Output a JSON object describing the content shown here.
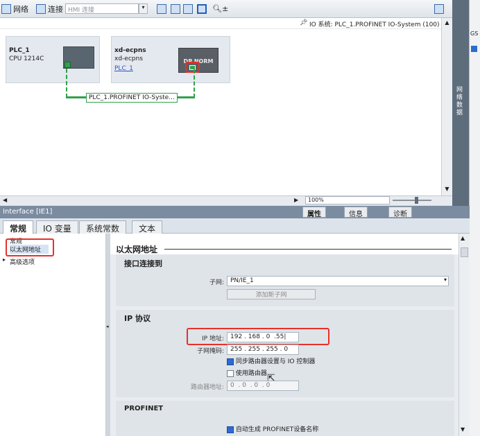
{
  "toolbar": {
    "network_label": "网络",
    "connection_label": "连接",
    "connection_type": "HMI 连接"
  },
  "canvas": {
    "io_system_label": "IO 系统: PLC_1.PROFINET IO-System (100)",
    "plc": {
      "name": "PLC_1",
      "type": "CPU 1214C"
    },
    "device": {
      "name": "xd-ecpns",
      "type": "xd-ecpns",
      "controller_link": "PLC_1",
      "badge": "DP NORM"
    },
    "network_line_label": "PLC_1.PROFINET IO-Syste...",
    "zoom_value": "100%"
  },
  "side_panel_label": "网络数据",
  "right_edge_text": "GS",
  "interface_title": "Interface [IE1]",
  "inspector_tabs": [
    "属性",
    "信息",
    "诊断"
  ],
  "tabs": [
    "常规",
    "IO 变量",
    "系统常数",
    "文本"
  ],
  "nav": {
    "items": [
      "常规",
      "以太网地址",
      "高级选项"
    ]
  },
  "props": {
    "section_title": "以太网地址",
    "interface_connected": "接口连接到",
    "subnet_label": "子网:",
    "subnet_value": "PN/IE_1",
    "add_subnet_button": "添加新子网",
    "ip_protocol": "IP 协议",
    "ip_label": "IP 地址:",
    "ip_octets": [
      "192",
      "168",
      "0",
      "55"
    ],
    "mask_label": "子网掩码:",
    "mask_octets": [
      "255",
      "255",
      "255",
      "0"
    ],
    "sync_router_label": "同步路由器设置与 IO 控制器",
    "use_router_label": "使用路由器",
    "router_label": "路由器地址:",
    "router_octets": [
      "0",
      "0",
      "0",
      "0"
    ],
    "profinet_title": "PROFINET",
    "auto_name_label": "自动生成 PROFINET设备名称"
  },
  "colors": {
    "network_green": "#2fa24a",
    "highlight_red": "#e6302a",
    "header_bar": "#7b8ba0"
  }
}
